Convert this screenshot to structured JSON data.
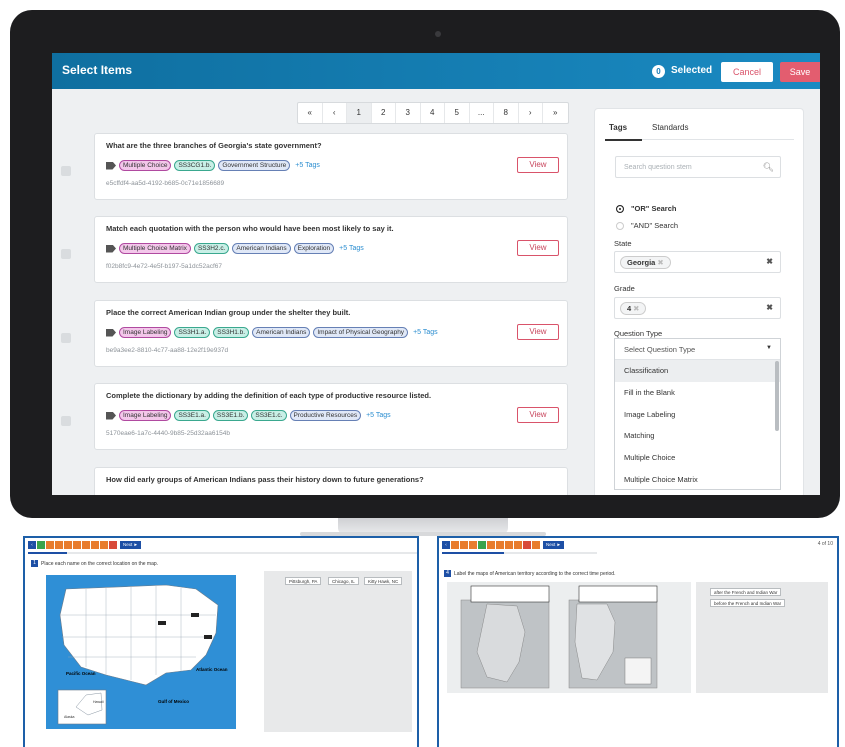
{
  "header": {
    "title": "Select Items",
    "selected_count": "0",
    "selected_label": "Selected",
    "cancel_label": "Cancel",
    "save_label": "Save"
  },
  "pager": [
    "«",
    "‹",
    "1",
    "2",
    "3",
    "4",
    "5",
    "...",
    "8",
    "›",
    "»"
  ],
  "questions": [
    {
      "text": "What are the three branches of Georgia's state government?",
      "tags": [
        "Multiple Choice",
        "SS3CG1.b.",
        "Government Structure"
      ],
      "more": "+5 Tags",
      "id": "e5cffdf4-aa5d-4192-b685-0c71e1856689",
      "view": "View"
    },
    {
      "text": "Match each quotation with the person who would have been most likely to say it.",
      "tags": [
        "Multiple Choice Matrix",
        "SS3H2.c.",
        "American Indians",
        "Exploration"
      ],
      "more": "+5 Tags",
      "id": "f02b8fc9-4e72-4e5f-b197-5a1dc52acf67",
      "view": "View"
    },
    {
      "text": "Place the correct American Indian group under the shelter they built.",
      "tags": [
        "Image Labeling",
        "SS3H1.a.",
        "SS3H1.b.",
        "American Indians",
        "Impact of Physical Geography"
      ],
      "more": "+5 Tags",
      "id": "be9a3ee2-8810-4c77-aa88-12e2f19e937d",
      "view": "View"
    },
    {
      "text": "Complete the dictionary by adding the definition of each type of productive resource listed.",
      "tags": [
        "Image Labeling",
        "SS3E1.a.",
        "SS3E1.b.",
        "SS3E1.c.",
        "Productive Resources"
      ],
      "more": "+5 Tags",
      "id": "5170eae6-1a7c-4440-9b85-25d32aa6154b",
      "view": "View"
    },
    {
      "text": "How did early groups of American Indians pass their history down to future generations?"
    }
  ],
  "filters": {
    "tabs": [
      "Tags",
      "Standards"
    ],
    "search_placeholder": "Search question stem",
    "or_search": "\"OR\" Search",
    "and_search": "\"AND\" Search",
    "state_label": "State",
    "state_value": "Georgia",
    "grade_label": "Grade",
    "grade_value": "4",
    "qtype_label": "Question Type",
    "qtype_placeholder": "Select Question Type",
    "qtype_options": [
      "Classification",
      "Fill in the Blank",
      "Image Labeling",
      "Matching",
      "Multiple Choice",
      "Multiple Choice Matrix"
    ]
  },
  "left_tile": {
    "instruction": "Place each name on the correct location on the map.",
    "answers": [
      "Pittsburgh, PA",
      "Chicago, IL",
      "Kitty Hawk, NC"
    ],
    "map_labels": [
      "Pacific Ocean",
      "Atlantic Ocean",
      "Gulf of Mexico"
    ],
    "next": "Next ►"
  },
  "right_tile": {
    "page": "4 of 10",
    "instruction": "Label the maps of American territory according to the correct time period.",
    "answers": [
      "after the French and Indian War",
      "before the French and Indian War"
    ],
    "next": "Next ►"
  }
}
